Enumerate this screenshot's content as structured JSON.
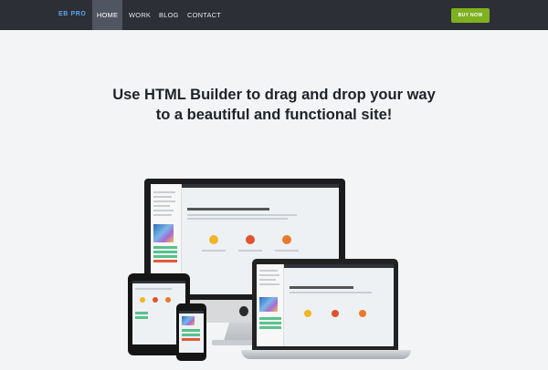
{
  "nav": {
    "brand": "EB PRO",
    "items": [
      {
        "label": "HOME",
        "active": true
      },
      {
        "label": "WORK",
        "active": false
      },
      {
        "label": "BLOG",
        "active": false
      },
      {
        "label": "CONTACT",
        "active": false
      }
    ],
    "buy_label": "BUY NOW"
  },
  "hero": {
    "line1": "Use HTML Builder to drag and drop your way",
    "line2": "to a beautiful and functional site!"
  },
  "colors": {
    "nav_bg": "#2c2f36",
    "brand": "#5aa9e6",
    "buy_button": "#7fb020",
    "page_bg": "#f3f4f6"
  },
  "icons": [
    "apple-logo-icon"
  ]
}
